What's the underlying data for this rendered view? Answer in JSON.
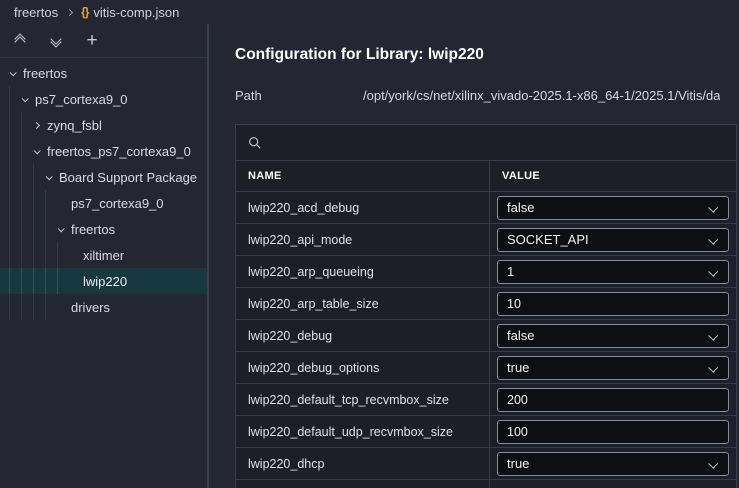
{
  "breadcrumb": {
    "project": "freertos",
    "file": "vitis-comp.json",
    "file_icon_glyph": "{}"
  },
  "sidebar": {
    "toolbar": {
      "collapse_all": "collapse-all",
      "expand_all": "expand-all",
      "add": {
        "name": "add",
        "glyph": "+"
      }
    },
    "tree": [
      {
        "label": "freertos",
        "level": 0,
        "chevron": "down",
        "selected": false
      },
      {
        "label": "ps7_cortexa9_0",
        "level": 1,
        "chevron": "down",
        "selected": false
      },
      {
        "label": "zynq_fsbl",
        "level": 2,
        "chevron": "right",
        "selected": false
      },
      {
        "label": "freertos_ps7_cortexa9_0",
        "level": 2,
        "chevron": "down",
        "selected": false
      },
      {
        "label": "Board Support Package",
        "level": 3,
        "chevron": "down",
        "selected": false
      },
      {
        "label": "ps7_cortexa9_0",
        "level": 4,
        "chevron": "none",
        "selected": false
      },
      {
        "label": "freertos",
        "level": 4,
        "chevron": "down",
        "selected": false
      },
      {
        "label": "xiltimer",
        "level": 5,
        "chevron": "none",
        "selected": false
      },
      {
        "label": "lwip220",
        "level": 5,
        "chevron": "none",
        "selected": true
      },
      {
        "label": "drivers",
        "level": 4,
        "chevron": "none",
        "selected": false
      }
    ]
  },
  "main": {
    "title": "Configuration for Library: lwip220",
    "path_label": "Path",
    "path_value": "/opt/york/cs/net/xilinx_vivado-2025.1-x86_64-1/2025.1/Vitis/da",
    "search_placeholder": "",
    "table": {
      "columns": [
        "NAME",
        "VALUE"
      ],
      "rows": [
        {
          "name": "lwip220_acd_debug",
          "value": "false",
          "control": "select"
        },
        {
          "name": "lwip220_api_mode",
          "value": "SOCKET_API",
          "control": "select"
        },
        {
          "name": "lwip220_arp_queueing",
          "value": "1",
          "control": "select"
        },
        {
          "name": "lwip220_arp_table_size",
          "value": "10",
          "control": "input"
        },
        {
          "name": "lwip220_debug",
          "value": "false",
          "control": "select"
        },
        {
          "name": "lwip220_debug_options",
          "value": "true",
          "control": "select"
        },
        {
          "name": "lwip220_default_tcp_recvmbox_size",
          "value": "200",
          "control": "input"
        },
        {
          "name": "lwip220_default_udp_recvmbox_size",
          "value": "100",
          "control": "input"
        },
        {
          "name": "lwip220_dhcp",
          "value": "true",
          "control": "select"
        }
      ]
    }
  },
  "colors": {
    "background": "#242631",
    "table_cell": "#1c1e28",
    "border": "#3a3e4c",
    "control_bg": "#0d0f15",
    "control_border": "#878b99",
    "selection_teal": "#17383f",
    "json_icon_orange": "#e2a33d",
    "text": "#d8dbe3"
  }
}
